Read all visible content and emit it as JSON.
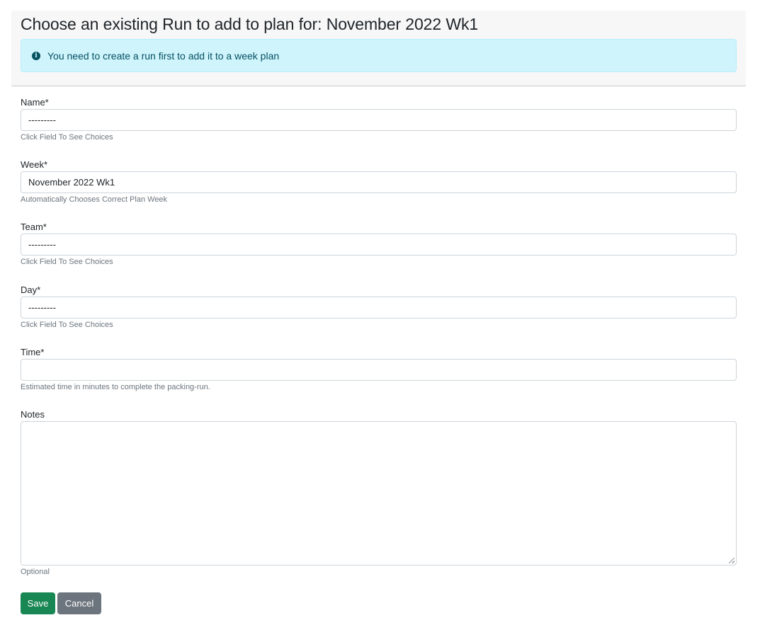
{
  "page": {
    "title": "Choose an existing Run to add to plan for: November 2022 Wk1"
  },
  "alert": {
    "icon": "info-circle-icon",
    "message": "You need to create a run first to add it to a week plan",
    "background": "#cff4fc",
    "color": "#055160"
  },
  "form": {
    "name": {
      "label": "Name*",
      "value": "---------",
      "help": "Click Field To See Choices"
    },
    "week": {
      "label": "Week*",
      "value": "November 2022 Wk1",
      "help": "Automatically Chooses Correct Plan Week"
    },
    "team": {
      "label": "Team*",
      "value": "---------",
      "help": "Click Field To See Choices"
    },
    "day": {
      "label": "Day*",
      "value": "---------",
      "help": "Click Field To See Choices"
    },
    "time": {
      "label": "Time*",
      "value": "",
      "help": "Estimated time in minutes to complete the packing-run."
    },
    "notes": {
      "label": "Notes",
      "value": "",
      "help": "Optional"
    }
  },
  "actions": {
    "save_label": "Save",
    "cancel_label": "Cancel",
    "save_color": "#198754",
    "cancel_color": "#6c757d"
  }
}
